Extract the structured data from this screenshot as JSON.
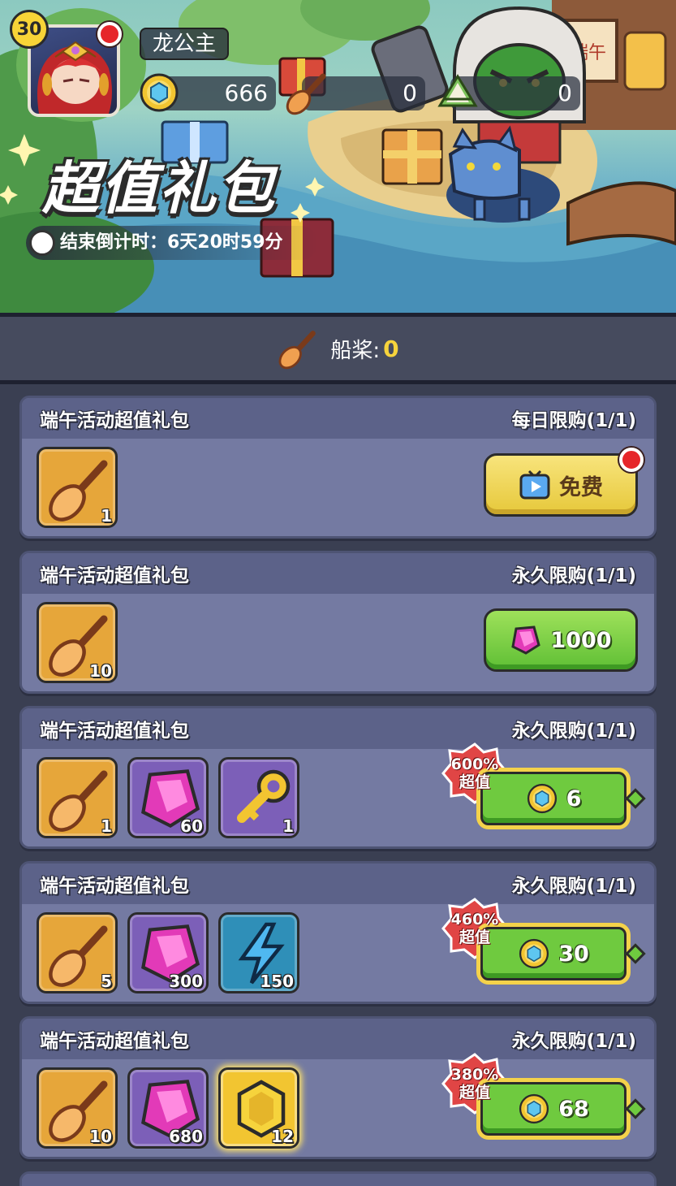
{
  "player": {
    "level": "30",
    "name": "龙公主"
  },
  "resources": [
    {
      "icon": "blue-gem-coin-icon",
      "value": "666"
    },
    {
      "icon": "paddle-icon",
      "value": "0"
    },
    {
      "icon": "zongzi-icon",
      "value": "0"
    }
  ],
  "banner": {
    "title": "超值礼包",
    "countdown": "结束倒计时：6天20时59分",
    "sign_text": "端午"
  },
  "strip": {
    "label": "船桨:",
    "value": "0"
  },
  "packs": [
    {
      "title": "端午活动超值礼包",
      "limit": "每日限购(1/1)",
      "items": [
        {
          "icon": "paddle-icon",
          "qty": "1"
        }
      ],
      "button": {
        "type": "free",
        "label": "免费",
        "icon": "video-ad-icon"
      }
    },
    {
      "title": "端午活动超值礼包",
      "limit": "永久限购(1/1)",
      "items": [
        {
          "icon": "paddle-icon",
          "qty": "10"
        }
      ],
      "button": {
        "type": "gem",
        "label": "1000",
        "icon": "pink-gem-icon"
      }
    },
    {
      "title": "端午活动超值礼包",
      "limit": "永久限购(1/1)",
      "items": [
        {
          "icon": "paddle-icon",
          "qty": "1"
        },
        {
          "icon": "pink-gem-icon",
          "qty": "60"
        },
        {
          "icon": "gold-key-icon",
          "qty": "1"
        }
      ],
      "deal": {
        "percent": "600%",
        "word": "超值"
      },
      "button": {
        "type": "coin",
        "label": "6",
        "icon": "blue-gem-coin-icon"
      }
    },
    {
      "title": "端午活动超值礼包",
      "limit": "永久限购(1/1)",
      "items": [
        {
          "icon": "paddle-icon",
          "qty": "5"
        },
        {
          "icon": "pink-gem-icon",
          "qty": "300"
        },
        {
          "icon": "lightning-icon",
          "qty": "150"
        }
      ],
      "deal": {
        "percent": "460%",
        "word": "超值"
      },
      "button": {
        "type": "coin",
        "label": "30",
        "icon": "blue-gem-coin-icon"
      }
    },
    {
      "title": "端午活动超值礼包",
      "limit": "永久限购(1/1)",
      "items": [
        {
          "icon": "paddle-icon",
          "qty": "10"
        },
        {
          "icon": "pink-gem-icon",
          "qty": "680"
        },
        {
          "icon": "gold-coin-icon",
          "qty": "12"
        }
      ],
      "deal": {
        "percent": "380%",
        "word": "超值"
      },
      "button": {
        "type": "coin",
        "label": "68",
        "icon": "blue-gem-coin-icon"
      }
    }
  ],
  "colors": {
    "background": "#3a3f52",
    "card": "#747aa2",
    "card_header": "#5c6289",
    "accent_yellow": "#f6d33c",
    "button_green": "#6fca3f",
    "deal_red": "#e04545"
  }
}
